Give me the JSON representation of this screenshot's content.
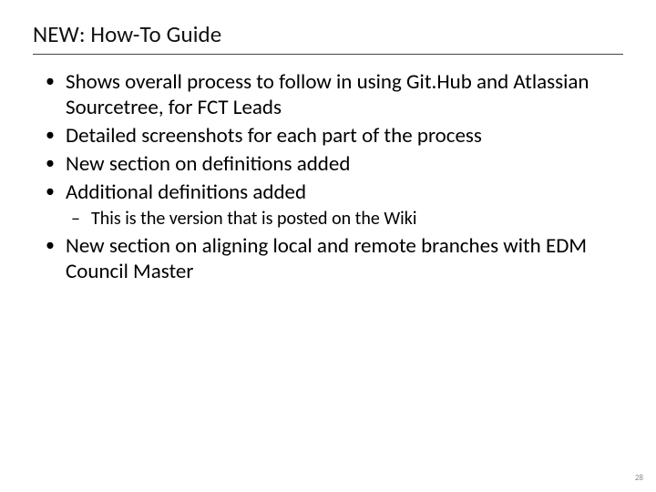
{
  "title": "NEW: How-To Guide",
  "bullets": [
    {
      "text": "Shows overall process to follow in using Git.Hub and Atlassian Sourcetree, for FCT Leads"
    },
    {
      "text": "Detailed screenshots for each part of the process"
    },
    {
      "text": "New section on definitions added"
    },
    {
      "text": "Additional definitions added",
      "sub": [
        {
          "text": "This is the version that is posted on the Wiki"
        }
      ]
    },
    {
      "text": "New section on aligning local and remote branches with EDM Council Master"
    }
  ],
  "page_number": "28"
}
